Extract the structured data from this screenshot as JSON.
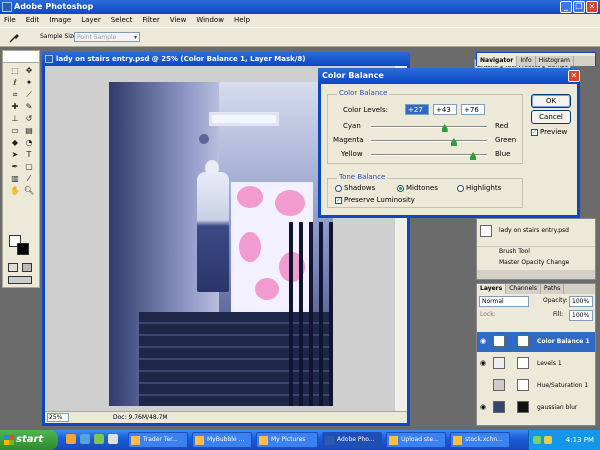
{
  "app": {
    "title": "Adobe Photoshop"
  },
  "menu": [
    "File",
    "Edit",
    "Image",
    "Layer",
    "Select",
    "Filter",
    "View",
    "Window",
    "Help"
  ],
  "options": {
    "sample_size_label": "Sample Size:",
    "sample_size_value": "Point Sample"
  },
  "palette_well": [
    "Brushe",
    "Tool Presets",
    "Comps"
  ],
  "document": {
    "title": "lady on stairs entry.psd @ 25% (Color Balance 1, Layer Mask/8)",
    "zoom": "25%",
    "doc_info": "Doc: 9.76M/48.7M"
  },
  "dialog": {
    "title": "Color Balance",
    "group_color": "Color Balance",
    "color_levels_label": "Color Levels:",
    "levels": [
      "+27",
      "+43",
      "+76"
    ],
    "sliders": [
      {
        "left": "Cyan",
        "right": "Red",
        "value": 27
      },
      {
        "left": "Magenta",
        "right": "Green",
        "value": 43
      },
      {
        "left": "Yellow",
        "right": "Blue",
        "value": 76
      }
    ],
    "group_tone": "Tone Balance",
    "tones": [
      "Shadows",
      "Midtones",
      "Highlights"
    ],
    "selected_tone": "Midtones",
    "preserve_label": "Preserve Luminosity",
    "ok": "OK",
    "cancel": "Cancel",
    "preview": "Preview"
  },
  "navigator_tabs": [
    "Navigator",
    "Info",
    "Histogram"
  ],
  "history": {
    "snapshot": "lady on stairs entry.psd",
    "items": [
      "Brush Tool",
      "Master Opacity Change"
    ]
  },
  "layers": {
    "tabs": [
      "Layers",
      "Channels",
      "Paths"
    ],
    "blend": "Normal",
    "opacity_label": "Opacity:",
    "opacity": "100%",
    "lock_label": "Lock:",
    "fill_label": "Fill:",
    "fill": "100%",
    "items": [
      "Color Balance 1",
      "Levels 1",
      "Hue/Saturation 1",
      "gaussian blur"
    ]
  },
  "taskbar": {
    "start": "start",
    "buttons": [
      "Trader Ter...",
      "MyBubble ...",
      "My Pictures",
      "Adobe Pho...",
      "Upload ste...",
      "stock.xchn..."
    ],
    "clock": "4:13 PM"
  },
  "colors": {
    "xp_blue": "#0a48c4",
    "dialog_bg": "#ece9d8",
    "accent_selection": "#316ac5",
    "taskbar": "#1c5ed8",
    "start_green": "#2e8b2e"
  }
}
